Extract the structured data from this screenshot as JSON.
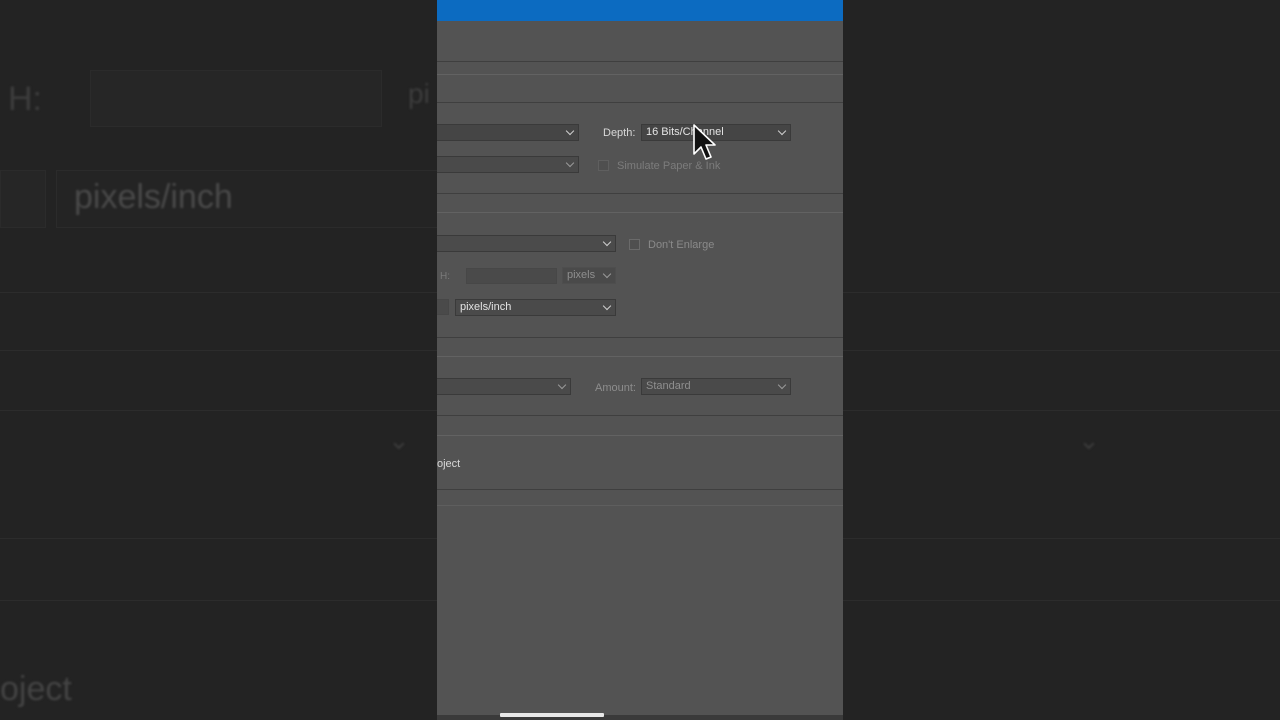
{
  "background": {
    "height_label": "H:",
    "resolution_unit": "pixels/inch",
    "partial_word": "oject"
  },
  "dialog": {
    "depth_label": "Depth:",
    "depth_value": "16 Bits/Channel",
    "simulate_label": "Simulate Paper & Ink",
    "dont_enlarge_label": "Don't Enlarge",
    "height_label": "H:",
    "height_unit": "pixels",
    "resolution_unit": "pixels/inch",
    "amount_label": "Amount:",
    "amount_value": "Standard",
    "partial_label": "oject"
  },
  "colors": {
    "titlebar": "#0c6bc1",
    "dialog_bg": "#535353",
    "page_bg": "#232323"
  },
  "icons": {
    "cursor": "arrow-cursor-icon",
    "chevron": "chevron-down-icon"
  }
}
